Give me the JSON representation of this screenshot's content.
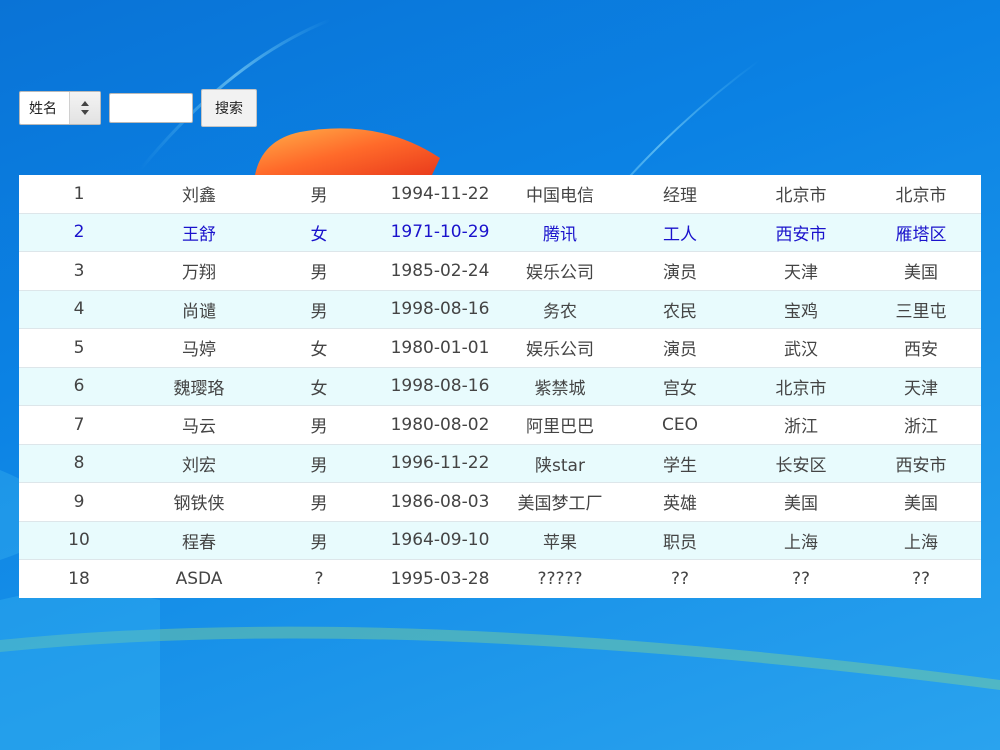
{
  "search": {
    "field_select": "姓名",
    "query_value": "",
    "button_label": "搜索"
  },
  "colors": {
    "row_even_background": "#e8fbfd",
    "row_highlight_text": "#1a12cc",
    "row_text": "#444444"
  },
  "table": {
    "rows": [
      {
        "id": "1",
        "name": "刘鑫",
        "gender": "男",
        "birthday": "1994-11-22",
        "company": "中国电信",
        "job": "经理",
        "city": "北京市",
        "district": "北京市",
        "highlighted": false
      },
      {
        "id": "2",
        "name": "王舒",
        "gender": "女",
        "birthday": "1971-10-29",
        "company": "腾讯",
        "job": "工人",
        "city": "西安市",
        "district": "雁塔区",
        "highlighted": true
      },
      {
        "id": "3",
        "name": "万翔",
        "gender": "男",
        "birthday": "1985-02-24",
        "company": "娱乐公司",
        "job": "演员",
        "city": "天津",
        "district": "美国",
        "highlighted": false
      },
      {
        "id": "4",
        "name": "尚谴",
        "gender": "男",
        "birthday": "1998-08-16",
        "company": "务农",
        "job": "农民",
        "city": "宝鸡",
        "district": "三里屯",
        "highlighted": false
      },
      {
        "id": "5",
        "name": "马婷",
        "gender": "女",
        "birthday": "1980-01-01",
        "company": "娱乐公司",
        "job": "演员",
        "city": "武汉",
        "district": "西安",
        "highlighted": false
      },
      {
        "id": "6",
        "name": "魏璎珞",
        "gender": "女",
        "birthday": "1998-08-16",
        "company": "紫禁城",
        "job": "宫女",
        "city": "北京市",
        "district": "天津",
        "highlighted": false
      },
      {
        "id": "7",
        "name": "马云",
        "gender": "男",
        "birthday": "1980-08-02",
        "company": "阿里巴巴",
        "job": "CEO",
        "city": "浙江",
        "district": "浙江",
        "highlighted": false
      },
      {
        "id": "8",
        "name": "刘宏",
        "gender": "男",
        "birthday": "1996-11-22",
        "company": "陕star",
        "job": "学生",
        "city": "长安区",
        "district": "西安市",
        "highlighted": false
      },
      {
        "id": "9",
        "name": "钢铁侠",
        "gender": "男",
        "birthday": "1986-08-03",
        "company": "美国梦工厂",
        "job": "英雄",
        "city": "美国",
        "district": "美国",
        "highlighted": false
      },
      {
        "id": "10",
        "name": "程春",
        "gender": "男",
        "birthday": "1964-09-10",
        "company": "苹果",
        "job": "职员",
        "city": "上海",
        "district": "上海",
        "highlighted": false
      },
      {
        "id": "18",
        "name": "ASDA",
        "gender": "?",
        "birthday": "1995-03-28",
        "company": "?????",
        "job": "??",
        "city": "??",
        "district": "??",
        "highlighted": false
      }
    ]
  }
}
